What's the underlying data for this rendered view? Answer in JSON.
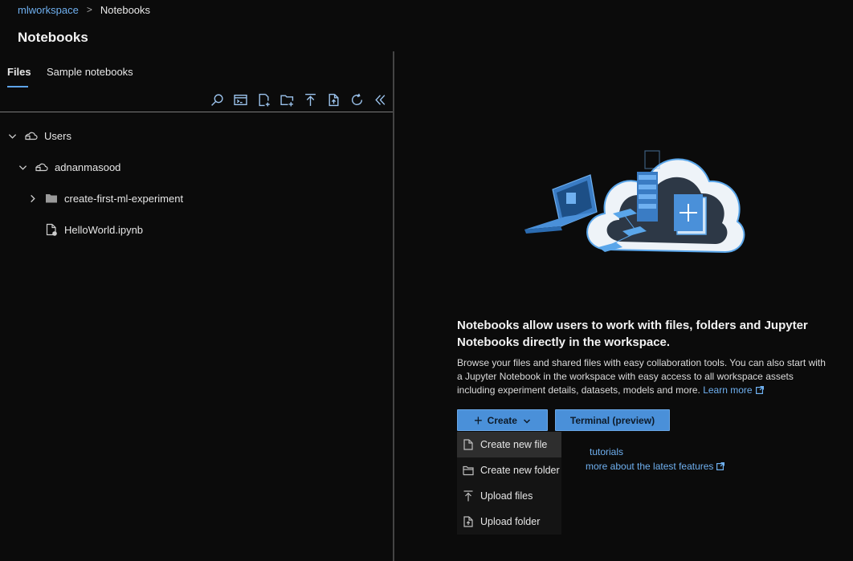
{
  "breadcrumb": {
    "workspace": "mlworkspace",
    "current": "Notebooks"
  },
  "page": {
    "title": "Notebooks"
  },
  "tabs": [
    {
      "label": "Files",
      "active": true
    },
    {
      "label": "Sample notebooks",
      "active": false
    }
  ],
  "toolbar": [
    "search-icon",
    "terminal-icon",
    "new-file-icon",
    "new-folder-icon",
    "upload-icon",
    "upload-folder-icon",
    "refresh-icon",
    "collapse-icon"
  ],
  "tree": {
    "root": "Users",
    "user": "adnanmasood",
    "folder": "create-first-ml-experiment",
    "file": "HelloWorld.ipynb"
  },
  "intro": {
    "headline": "Notebooks allow users to work with files, folders and Jupyter Notebooks directly in the workspace.",
    "description": "Browse your files and shared files with easy collaboration tools. You can also start with a Jupyter Notebook in the workspace with easy access to all workspace assets including experiment details, datasets, models and more.",
    "learn_more": "Learn more"
  },
  "actions": {
    "create": "Create",
    "terminal": "Terminal (preview)"
  },
  "partial_links": {
    "tutorials": "tutorials",
    "features": "more about the latest features"
  },
  "create_menu": {
    "new_file": "Create new file",
    "new_folder": "Create new folder",
    "upload_files": "Upload files",
    "upload_folder": "Upload folder"
  },
  "colors": {
    "accent": "#4a90d9",
    "link": "#6fb0f0",
    "background": "#0b0b0b"
  }
}
